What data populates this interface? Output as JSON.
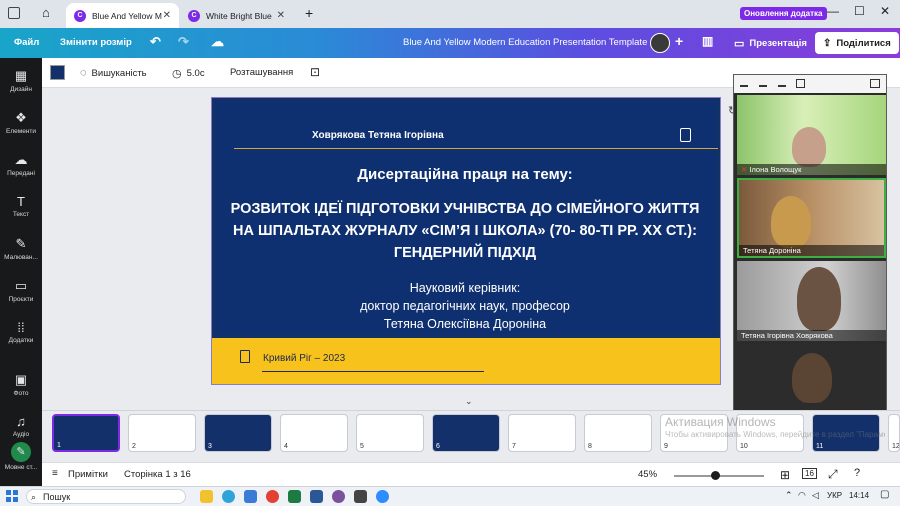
{
  "browser": {
    "tabs": [
      {
        "label": "Blue And Yellow M",
        "active": true
      },
      {
        "label": "White Bright Blue",
        "active": false
      }
    ],
    "update_label": "Оновлення додатка"
  },
  "header": {
    "file": "Файл",
    "resize": "Змінити розмір",
    "doc_title": "Blue And Yellow Modern Education Presentation Template",
    "present": "Презентація",
    "share": "Поділитися"
  },
  "rail": [
    {
      "label": "Дизайн",
      "icon": "layout-icon"
    },
    {
      "label": "Елементи",
      "icon": "elements-icon"
    },
    {
      "label": "Передані",
      "icon": "upload-icon"
    },
    {
      "label": "Текст",
      "icon": "text-icon"
    },
    {
      "label": "Малюван...",
      "icon": "draw-icon"
    },
    {
      "label": "Проєкти",
      "icon": "folder-icon"
    },
    {
      "label": "Додатки",
      "icon": "apps-icon"
    },
    {
      "label": "Фото",
      "icon": "photo-icon"
    },
    {
      "label": "Аудіо",
      "icon": "audio-icon"
    },
    {
      "label": "Мовне ст...",
      "icon": "magic-icon"
    }
  ],
  "toolbar": {
    "transparency": "Вишуканість",
    "duration": "5.0с",
    "position": "Розташування"
  },
  "slide": {
    "author": "Ховрякова  Тетяна Ігорівна",
    "topic_label": "Дисертаційна праця на тему:",
    "topic": "РОЗВИТОК ІДЕЇ ПІДГОТОВКИ УЧНІВСТВА ДО СІМЕЙНОГО ЖИТТЯ НА ШПАЛЬТАХ ЖУРНАЛУ «СІМ’Я І ШКОЛА» (70- 80-ТІ РР. ХХ СТ.): ГЕНДЕРНИЙ ПІДХІД",
    "supervisor_label": "Науковий керівник:",
    "supervisor_title": "доктор педагогічних наук, професор",
    "supervisor_name": "Тетяна Олексіївна Дороніна",
    "city_year": "Кривий Ріг – 2023"
  },
  "call": {
    "participants": [
      {
        "name": "Ілона Волощук"
      },
      {
        "name": "Тетяна Дороніна"
      },
      {
        "name": "Тетяна Ігорівна Ховрякова"
      },
      {
        "name": ""
      }
    ]
  },
  "thumbnails": [
    "1",
    "2",
    "3",
    "4",
    "5",
    "6",
    "7",
    "8",
    "9",
    "10",
    "11",
    "12"
  ],
  "statusbar": {
    "notes": "Примітки",
    "page": "Сторінка 1 з 16",
    "zoom": "45%",
    "zoom_fraction": 0.45,
    "pages_count": "16"
  },
  "taskbar": {
    "search": "Пошук",
    "lang": "УКР",
    "time": "14:14"
  },
  "watermark": {
    "line1": "Активация Windows",
    "line2": "Чтобы активировать Windows, перейдите в раздел \"Параметры\"."
  }
}
